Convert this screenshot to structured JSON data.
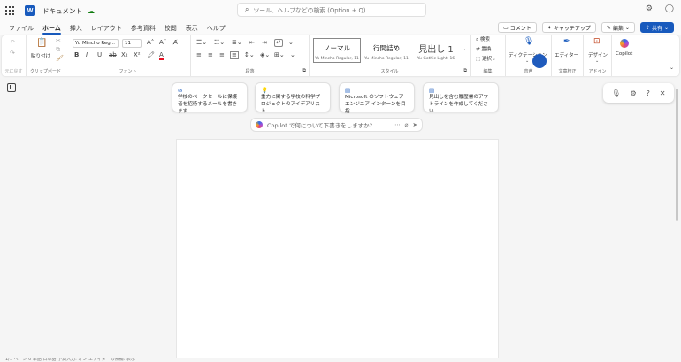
{
  "titlebar": {
    "app_icon_letter": "W",
    "doc_title": "ドキュメント",
    "search_placeholder": "ツール、ヘルプなどの検索 (Option + Q)"
  },
  "menubar": {
    "tabs": [
      {
        "label": "ファイル",
        "active": false
      },
      {
        "label": "ホーム",
        "active": true
      },
      {
        "label": "挿入",
        "active": false
      },
      {
        "label": "レイアウト",
        "active": false
      },
      {
        "label": "参考資料",
        "active": false
      },
      {
        "label": "校閲",
        "active": false
      },
      {
        "label": "表示",
        "active": false
      },
      {
        "label": "ヘルプ",
        "active": false
      }
    ],
    "comment_label": "コメント",
    "catchup_label": "キャッチアップ",
    "edit_label": "編集",
    "share_label": "共有"
  },
  "ribbon": {
    "undo_label": "元に戻す",
    "clipboard": {
      "paste_label": "貼り付け",
      "group_label": "クリップボード"
    },
    "font": {
      "font_name": "Yu Mincho Reg...",
      "font_size": "11",
      "group_label": "フォント"
    },
    "paragraph": {
      "group_label": "段落"
    },
    "styles": {
      "items": [
        {
          "name": "ノーマル",
          "sub": "Yu Mincho Regular, 11"
        },
        {
          "name": "行間詰め",
          "sub": "Yu Mincho Regular, 11"
        },
        {
          "name": "見出し 1",
          "sub": "Yu Gothic Light, 16"
        }
      ],
      "group_label": "スタイル"
    },
    "editing": {
      "find_label": "検索",
      "replace_label": "置換",
      "select_label": "選択",
      "group_label": "編集"
    },
    "voice": {
      "dictate_label": "ディクテーション",
      "group_label": "音声"
    },
    "editor": {
      "label": "エディター",
      "group_label": "文章校正"
    },
    "designer": {
      "label": "デザイン",
      "group_label": "アドイン"
    },
    "copilot": {
      "label": "Copilot"
    }
  },
  "suggestions": [
    {
      "text": "学校のベークセールに保護者を招待するメールを書きます"
    },
    {
      "text": "重力に関する学校の科学プロジェクトのアイデアリスト..."
    },
    {
      "text": "Microsoft のソフトウェア エンジニア インターンを目指..."
    },
    {
      "text": "見出しを含む履歴書のアウトラインを作成してください"
    }
  ],
  "copilot_prompt": {
    "placeholder": "Copilot で何について下書きをしますか?"
  },
  "statusbar": {
    "text": "1/1 ページ  0 単語  日本語  予測入力: オン  エディターの候補: 表示"
  }
}
